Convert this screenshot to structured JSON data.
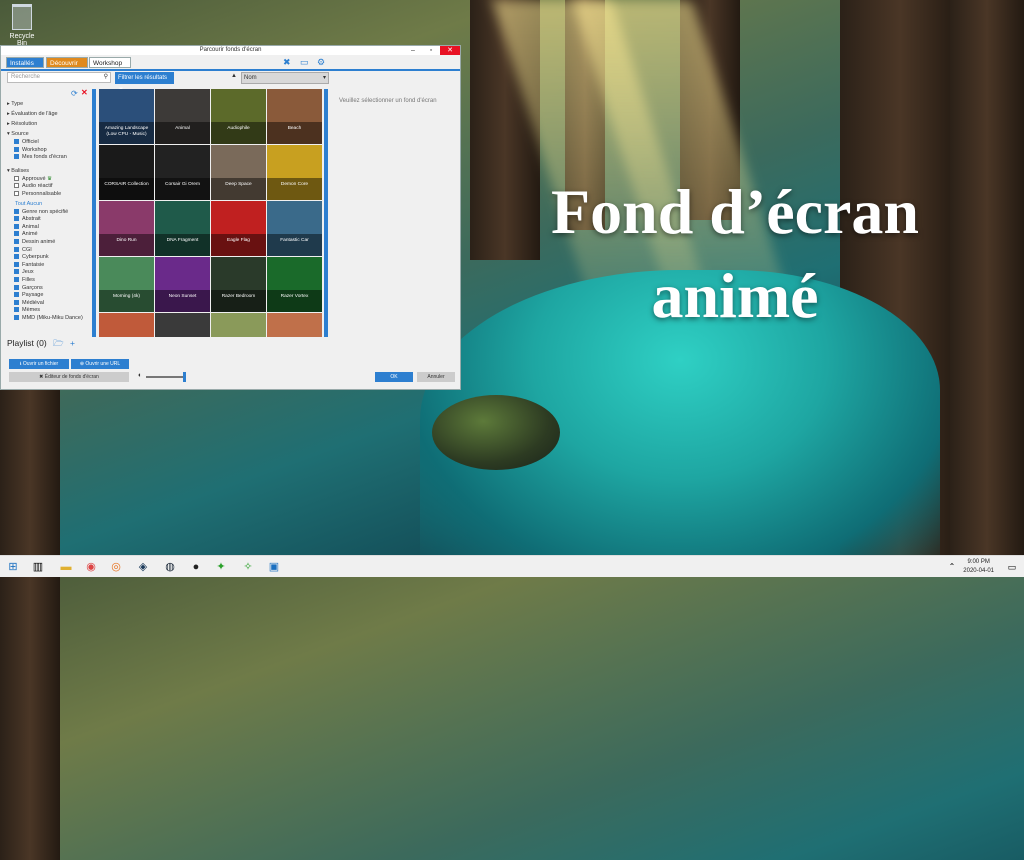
{
  "desktop": {
    "recycle_bin": "Recycle Bin",
    "overlay_title_line1": "Fond d’écran",
    "overlay_title_line2": "animé"
  },
  "window": {
    "title": "Parcourir fonds d'écran",
    "tabs": [
      "Installés",
      "Découvrir",
      "Workshop"
    ],
    "search_placeholder": "Recherche",
    "filter_button": "Filtrer les résultats",
    "sort_value": "Nom",
    "preview_text": "Veuillez sélectionner un fond d'écran",
    "filters": {
      "groups": [
        "Type",
        "Évaluation de l'âge",
        "Résolution",
        "Source"
      ],
      "source": [
        "Officiel",
        "Workshop",
        "Mes fonds d'écran"
      ],
      "balises_title": "Balises",
      "balises": [
        "Approuvé",
        "Audio réactif",
        "Personnalisable"
      ],
      "tout": "Tout",
      "aucun": "Aucun",
      "tags": [
        "Genre non spécifié",
        "Abstrait",
        "Animal",
        "Animé",
        "Dessin animé",
        "CGI",
        "Cyberpunk",
        "Fantaisie",
        "Jeux",
        "Filles",
        "Garçons",
        "Paysage",
        "Médiéval",
        "Mèmes",
        "MMD (Miku-Miku Dance)"
      ]
    },
    "wallpapers": [
      {
        "name": "Amazing Landscape (Low CPU - Music)",
        "color": "#2b4f7a"
      },
      {
        "name": "Animal",
        "color": "#3d3a38"
      },
      {
        "name": "Audiophile",
        "color": "#5c6a2a"
      },
      {
        "name": "Beach",
        "color": "#8a5a3a"
      },
      {
        "name": "CORSAIR Collection",
        "color": "#1a1a1a"
      },
      {
        "name": "Corsair Gi Orem",
        "color": "#222222"
      },
      {
        "name": "Deep Space",
        "color": "#7a6a5a"
      },
      {
        "name": "Demon Core",
        "color": "#c8a020"
      },
      {
        "name": "Dino Run",
        "color": "#8a3a6a"
      },
      {
        "name": "DNA Fragment",
        "color": "#1f5a4a"
      },
      {
        "name": "Eagle Flag",
        "color": "#c02020"
      },
      {
        "name": "Fantastic Car",
        "color": "#3a6a8a"
      },
      {
        "name": "Morning (4k)",
        "color": "#4a8a5a"
      },
      {
        "name": "Neon Sunset",
        "color": "#6a2a8a"
      },
      {
        "name": "Razer Bedroom",
        "color": "#2a3a2a"
      },
      {
        "name": "Razer Vortex",
        "color": "#1a6a2a"
      },
      {
        "name": "",
        "color": "#c05a3a"
      },
      {
        "name": "",
        "color": "#3a3a3a"
      },
      {
        "name": "",
        "color": "#8a9a5a"
      },
      {
        "name": "",
        "color": "#c0704a"
      }
    ],
    "playlist_label": "Playlist (0)",
    "btn_open_file": "Ouvrir un fichier",
    "btn_open_url": "Ouvrir une URL",
    "btn_editor": "Éditeur de fonds d'écran",
    "btn_ok": "OK",
    "btn_cancel": "Annuler"
  },
  "taskbar": {
    "time": "9:00 PM",
    "date": "2020-04-01",
    "icons": [
      "start-icon",
      "task-view-icon",
      "file-explorer-icon",
      "chrome-icon",
      "firefox-icon",
      "steam-alt-icon",
      "steam-icon",
      "obs-icon",
      "razer-icon",
      "razer-alt-icon",
      "wallpaper-engine-icon"
    ]
  }
}
